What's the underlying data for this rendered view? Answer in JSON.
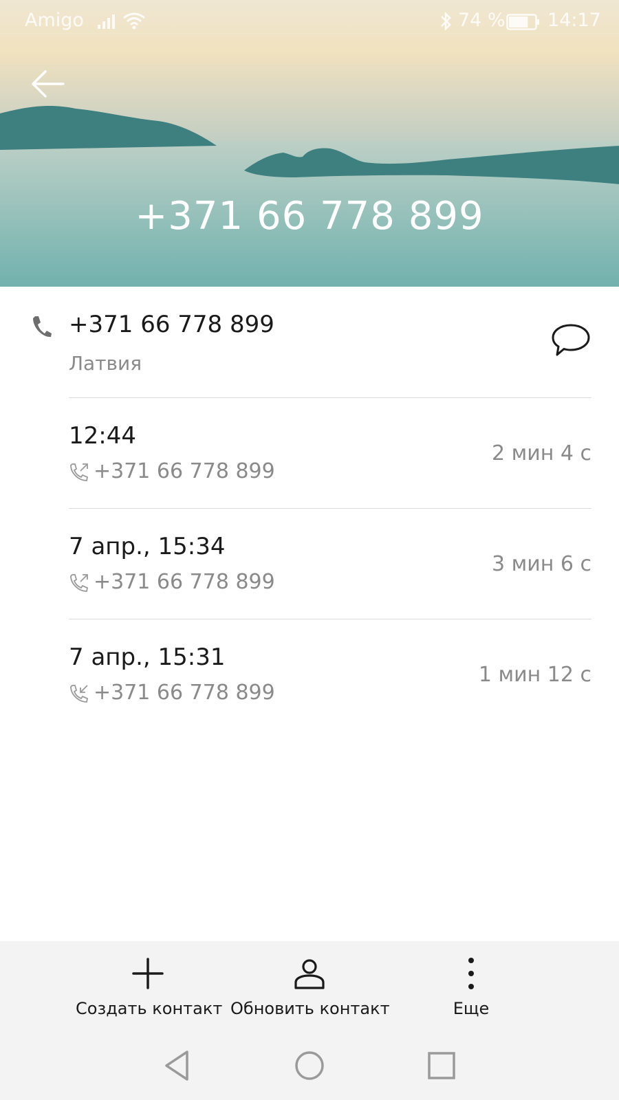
{
  "status_bar": {
    "carrier": "Amigo",
    "battery_percent": "74 %",
    "battery_level": 0.74,
    "time": "14:17",
    "icons": [
      "signal-icon",
      "wifi-icon",
      "bluetooth-icon",
      "battery-icon"
    ]
  },
  "header": {
    "number": "+371 66 778 899",
    "back_icon": "arrow-left-icon"
  },
  "contact": {
    "number": "+371 66 778 899",
    "country": "Латвия",
    "icons": [
      "phone-icon",
      "message-icon"
    ]
  },
  "calls": [
    {
      "time": "12:44",
      "number": "+371 66 778 899",
      "duration": "2 мин 4 с",
      "direction": "outgoing"
    },
    {
      "time": "7 апр., 15:34",
      "number": "+371 66 778 899",
      "duration": "3 мин 6 с",
      "direction": "outgoing"
    },
    {
      "time": "7 апр., 15:31",
      "number": "+371 66 778 899",
      "duration": "1 мин 12 с",
      "direction": "incoming"
    }
  ],
  "actions": {
    "create": "Создать контакт",
    "update": "Обновить контакт",
    "more": "Еще"
  },
  "nav": {
    "icons": [
      "back-triangle-icon",
      "home-circle-icon",
      "recents-square-icon"
    ]
  },
  "colors": {
    "text_primary": "#1a1a1a",
    "text_secondary": "#8a8a8a",
    "bar_background": "#f3f3f3"
  }
}
